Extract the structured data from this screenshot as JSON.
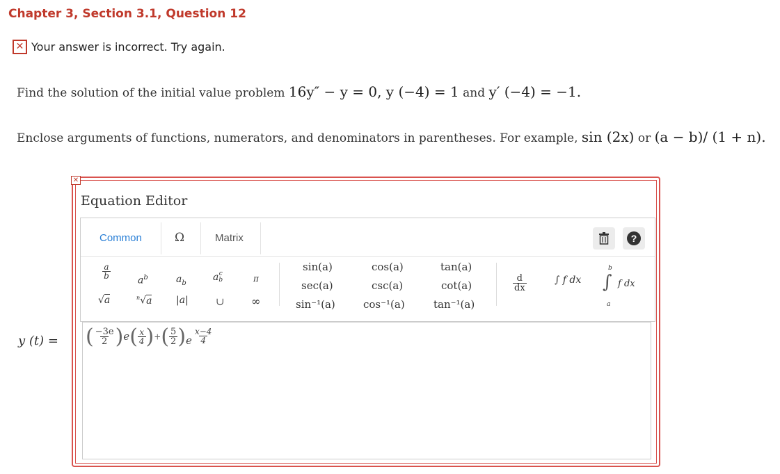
{
  "header": {
    "chapter": "Chapter 3, Section 3.1, Question 12"
  },
  "feedback": {
    "icon": "close-icon",
    "message": "Your answer is incorrect.  Try again."
  },
  "question": {
    "prefix": "Find the solution of the initial value problem",
    "equation": "16y″ − y = 0, y (−4) = 1",
    "conjunction": "and",
    "condition": "y′ (−4) = −1."
  },
  "instruction": {
    "text": "Enclose arguments of functions, numerators, and denominators in parentheses. For example,",
    "example1": "sin (2x)",
    "or": "or",
    "example2": "(a − b)/ (1 + n)."
  },
  "editor": {
    "title": "Equation Editor",
    "tabs": [
      "Common",
      "Ω",
      "Matrix"
    ],
    "palette": {
      "col1": {
        "frac_num": "a",
        "frac_den": "b",
        "sqrt": "a"
      },
      "col2": {
        "pow_base": "a",
        "pow_exp": "b",
        "nroot_index": "n",
        "nroot_base": "a"
      },
      "col3": {
        "sub_base": "a",
        "sub_idx": "b",
        "abs": "|a|"
      },
      "col4": {
        "base": "a",
        "sup": "c",
        "sub": "b",
        "union": "∪"
      },
      "col5": {
        "pi": "π",
        "infinity": "∞"
      },
      "trig1": [
        "sin(a)",
        "sec(a)",
        "sin⁻¹(a)"
      ],
      "trig2": [
        "cos(a)",
        "csc(a)",
        "cos⁻¹(a)"
      ],
      "trig3": [
        "tan(a)",
        "cot(a)",
        "tan⁻¹(a)"
      ],
      "deriv": {
        "num": "d",
        "den": "dx"
      },
      "integral": "∫ f dx",
      "def_integral": {
        "upper": "b",
        "lower": "a",
        "body": "f dx"
      }
    },
    "toolbar_icons": [
      "trash-icon",
      "help-icon"
    ],
    "help_glyph": "?"
  },
  "answer": {
    "label": "y (t) =",
    "term1_num": "−3e",
    "term1_den": "2",
    "e1": "e",
    "exp1_num": "x",
    "exp1_den": "4",
    "plus": "+",
    "term2_num": "5",
    "term2_den": "2",
    "e2": "e",
    "exp2_num": "x−4",
    "exp2_den": "4"
  },
  "colors": {
    "accent_red": "#c0392b",
    "tab_blue": "#2a7fd6",
    "error_border": "#d9534f"
  }
}
